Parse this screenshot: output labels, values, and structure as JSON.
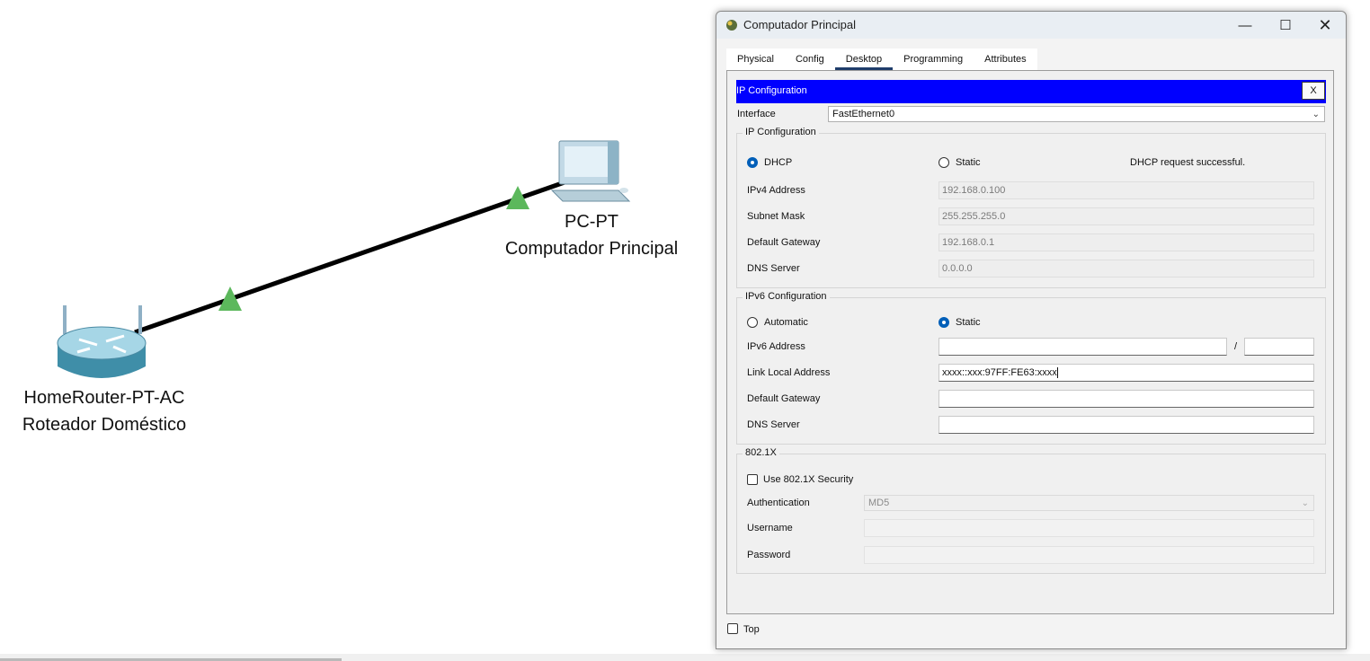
{
  "topology": {
    "router": {
      "model": "HomeRouter-PT-AC",
      "name": "Roteador Doméstico"
    },
    "pc": {
      "model": "PC-PT",
      "name": "Computador Principal"
    },
    "link_status_color": "#5cb85c"
  },
  "window": {
    "title": "Computador Principal",
    "controls": {
      "minimize": "—",
      "maximize": "☐",
      "close": "✕"
    }
  },
  "tabs": [
    {
      "label": "Physical",
      "active": false
    },
    {
      "label": "Config",
      "active": false
    },
    {
      "label": "Desktop",
      "active": true
    },
    {
      "label": "Programming",
      "active": false
    },
    {
      "label": "Attributes",
      "active": false
    }
  ],
  "ip_config": {
    "header": "IP Configuration",
    "close_label": "X",
    "header_color": "#0000ff",
    "interface_label": "Interface",
    "interface_value": "FastEthernet0",
    "ipv4": {
      "section_title": "IP Configuration",
      "mode_dhcp": "DHCP",
      "mode_static": "Static",
      "selected_mode": "DHCP",
      "status": "DHCP request successful.",
      "fields": {
        "ipv4_label": "IPv4 Address",
        "ipv4_value": "192.168.0.100",
        "mask_label": "Subnet Mask",
        "mask_value": "255.255.255.0",
        "gateway_label": "Default Gateway",
        "gateway_value": "192.168.0.1",
        "dns_label": "DNS Server",
        "dns_value": "0.0.0.0"
      }
    },
    "ipv6": {
      "section_title": "IPv6 Configuration",
      "mode_auto": "Automatic",
      "mode_static": "Static",
      "selected_mode": "Static",
      "address_label": "IPv6 Address",
      "address_value": "",
      "prefix_sep": "/",
      "prefix_value": "",
      "link_local_label": "Link Local Address",
      "link_local_value": "xxxx::xxx:97FF:FE63:xxxx",
      "gateway_label": "Default Gateway",
      "gateway_value": "",
      "dns_label": "DNS Server",
      "dns_value": ""
    },
    "dot1x": {
      "section_title": "802.1X",
      "use_label": "Use 802.1X Security",
      "use_checked": false,
      "auth_label": "Authentication",
      "auth_value": "MD5",
      "username_label": "Username",
      "username_value": "",
      "password_label": "Password",
      "password_value": ""
    }
  },
  "footer": {
    "top_label": "Top",
    "top_checked": false
  }
}
